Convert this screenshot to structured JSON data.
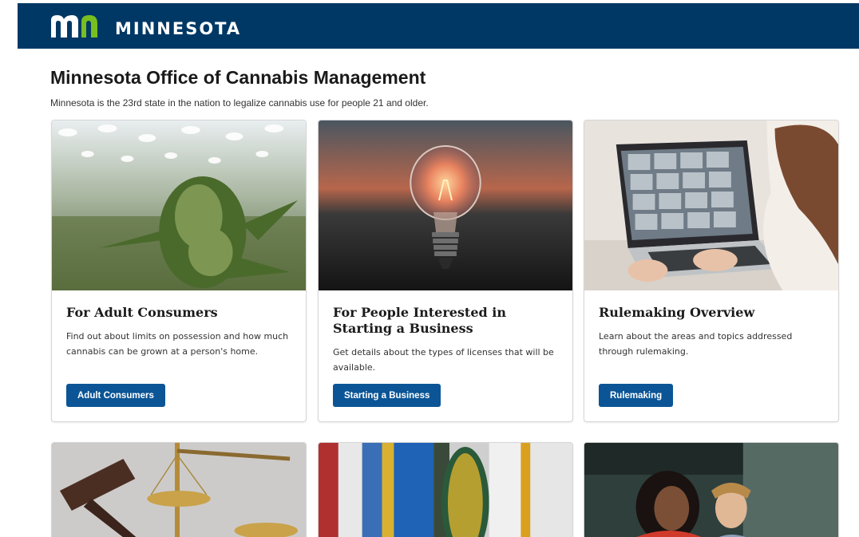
{
  "header": {
    "logo_text": "MINNESOTA",
    "background": "#003865"
  },
  "page": {
    "title": "Minnesota Office of Cannabis Management",
    "intro": "Minnesota is the 23rd state in the nation to legalize cannabis use for people 21 and older."
  },
  "cards": [
    {
      "title": "For Adult Consumers",
      "description": "Find out about limits on possession and how much cannabis can be grown at a person's home.",
      "button": "Adult Consumers",
      "image": "cannabis-plant-image"
    },
    {
      "title": "For People Interested in Starting a Business",
      "description": "Get details about the types of licenses that will be available.",
      "button": "Starting a Business",
      "image": "lightbulb-image"
    },
    {
      "title": "Rulemaking Overview",
      "description": "Learn about the areas and topics addressed through rulemaking.",
      "button": "Rulemaking",
      "image": "video-call-laptop-image"
    }
  ],
  "cards_row2": [
    {
      "image": "gavel-scales-image"
    },
    {
      "image": "flags-image"
    },
    {
      "image": "people-cafe-image"
    }
  ],
  "colors": {
    "button": "#0b5596",
    "brand_green": "#78be20"
  }
}
